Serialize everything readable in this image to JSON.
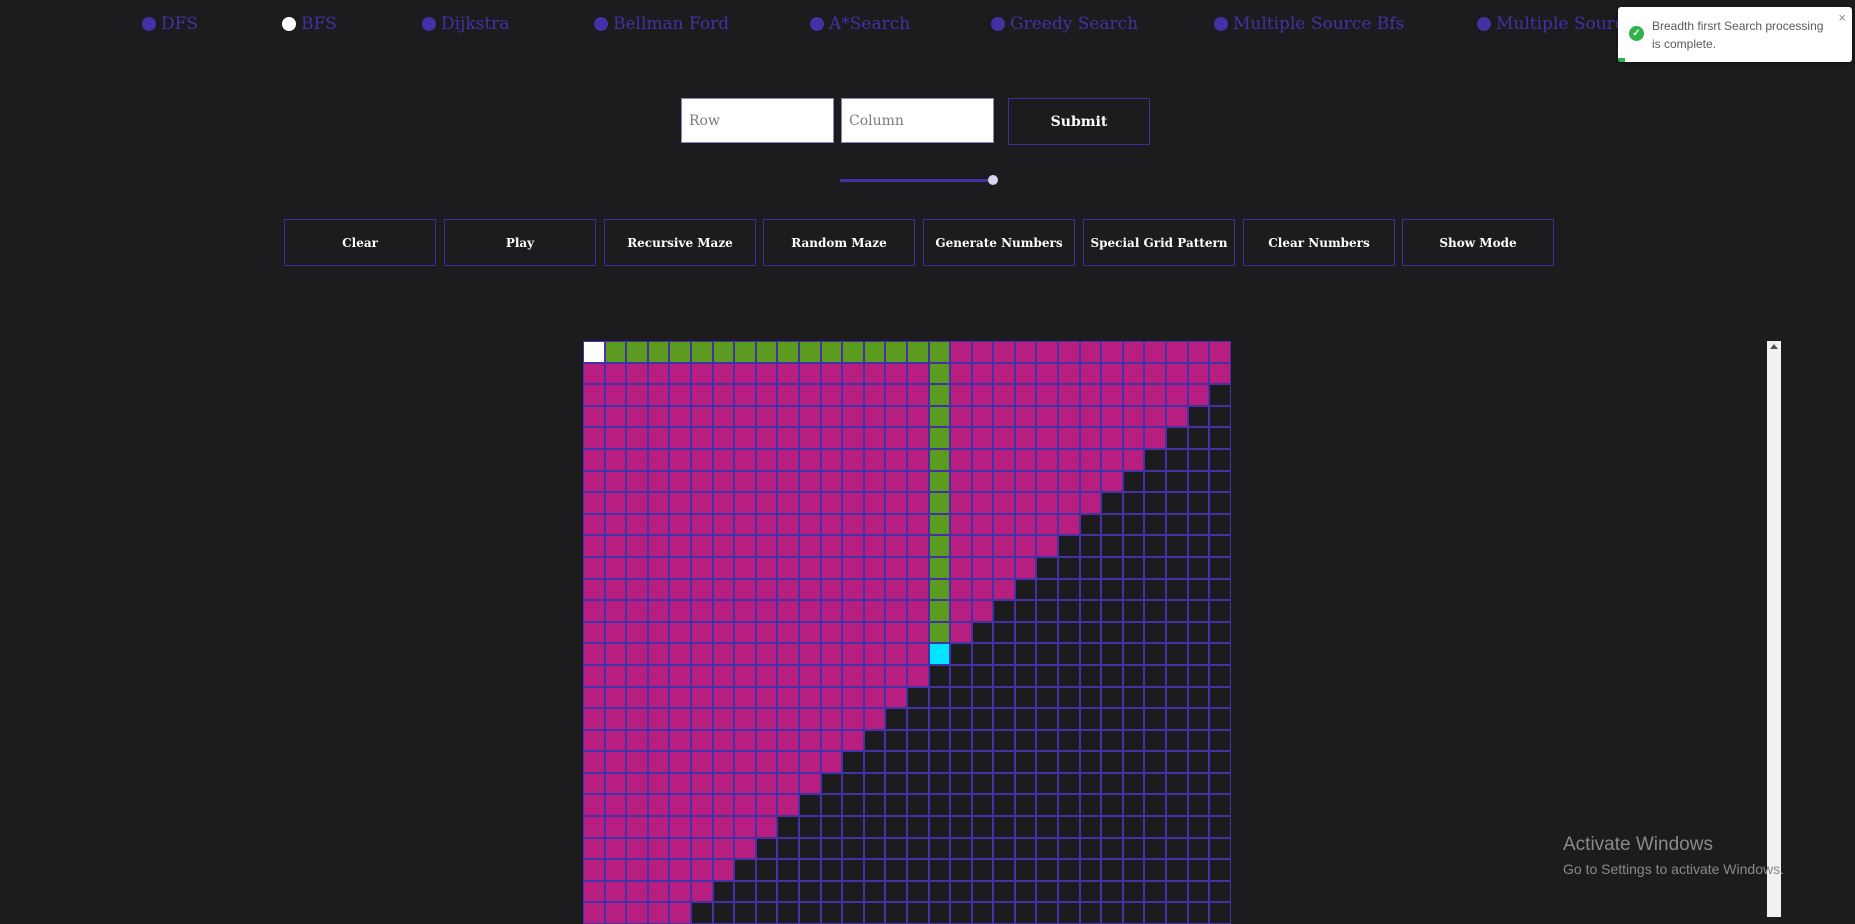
{
  "nav": {
    "items": [
      {
        "label": "DFS",
        "selected": false
      },
      {
        "label": "BFS",
        "selected": true
      },
      {
        "label": "Dijkstra",
        "selected": false
      },
      {
        "label": "Bellman Ford",
        "selected": false
      },
      {
        "label": "A*Search",
        "selected": false
      },
      {
        "label": "Greedy Search",
        "selected": false
      },
      {
        "label": "Multiple Source Bfs",
        "selected": false
      },
      {
        "label": "Multiple Source",
        "selected": false
      }
    ]
  },
  "form": {
    "row_placeholder": "Row",
    "column_placeholder": "Column",
    "submit_label": "Submit"
  },
  "speed": {
    "value": 1.0
  },
  "toolbar": {
    "buttons": [
      "Clear",
      "Play",
      "Recursive Maze",
      "Random Maze",
      "Generate Numbers",
      "Special Grid Pattern",
      "Clear Numbers",
      "Show Mode"
    ]
  },
  "grid": {
    "visible_rows": 27,
    "cols": 30,
    "start": [
      0,
      0
    ],
    "target": [
      14,
      16
    ],
    "path": [
      [
        0,
        1
      ],
      [
        0,
        2
      ],
      [
        0,
        3
      ],
      [
        0,
        4
      ],
      [
        0,
        5
      ],
      [
        0,
        6
      ],
      [
        0,
        7
      ],
      [
        0,
        8
      ],
      [
        0,
        9
      ],
      [
        0,
        10
      ],
      [
        0,
        11
      ],
      [
        0,
        12
      ],
      [
        0,
        13
      ],
      [
        0,
        14
      ],
      [
        0,
        15
      ],
      [
        0,
        16
      ],
      [
        1,
        16
      ],
      [
        2,
        16
      ],
      [
        3,
        16
      ],
      [
        4,
        16
      ],
      [
        5,
        16
      ],
      [
        6,
        16
      ],
      [
        7,
        16
      ],
      [
        8,
        16
      ],
      [
        9,
        16
      ],
      [
        10,
        16
      ],
      [
        11,
        16
      ],
      [
        12,
        16
      ],
      [
        13,
        16
      ]
    ],
    "visited_frontier": [
      30,
      30,
      29,
      28,
      27,
      26,
      25,
      24,
      23,
      22,
      21,
      20,
      19,
      18,
      17,
      16,
      15,
      14,
      13,
      12,
      11,
      10,
      9,
      8,
      7,
      6,
      5
    ],
    "colors": {
      "visited": "#b81e80",
      "path": "#5a9b20",
      "start": "#ffffff",
      "target": "#00e5ff",
      "empty": "#1c1b1d",
      "border": "#4531a6"
    }
  },
  "toast": {
    "message": "Breadth firsrt Search processing is complete.",
    "close": "×",
    "progress": 0.03
  },
  "watermark": {
    "title": "Activate Windows",
    "subtitle": "Go to Settings to activate Windows."
  }
}
